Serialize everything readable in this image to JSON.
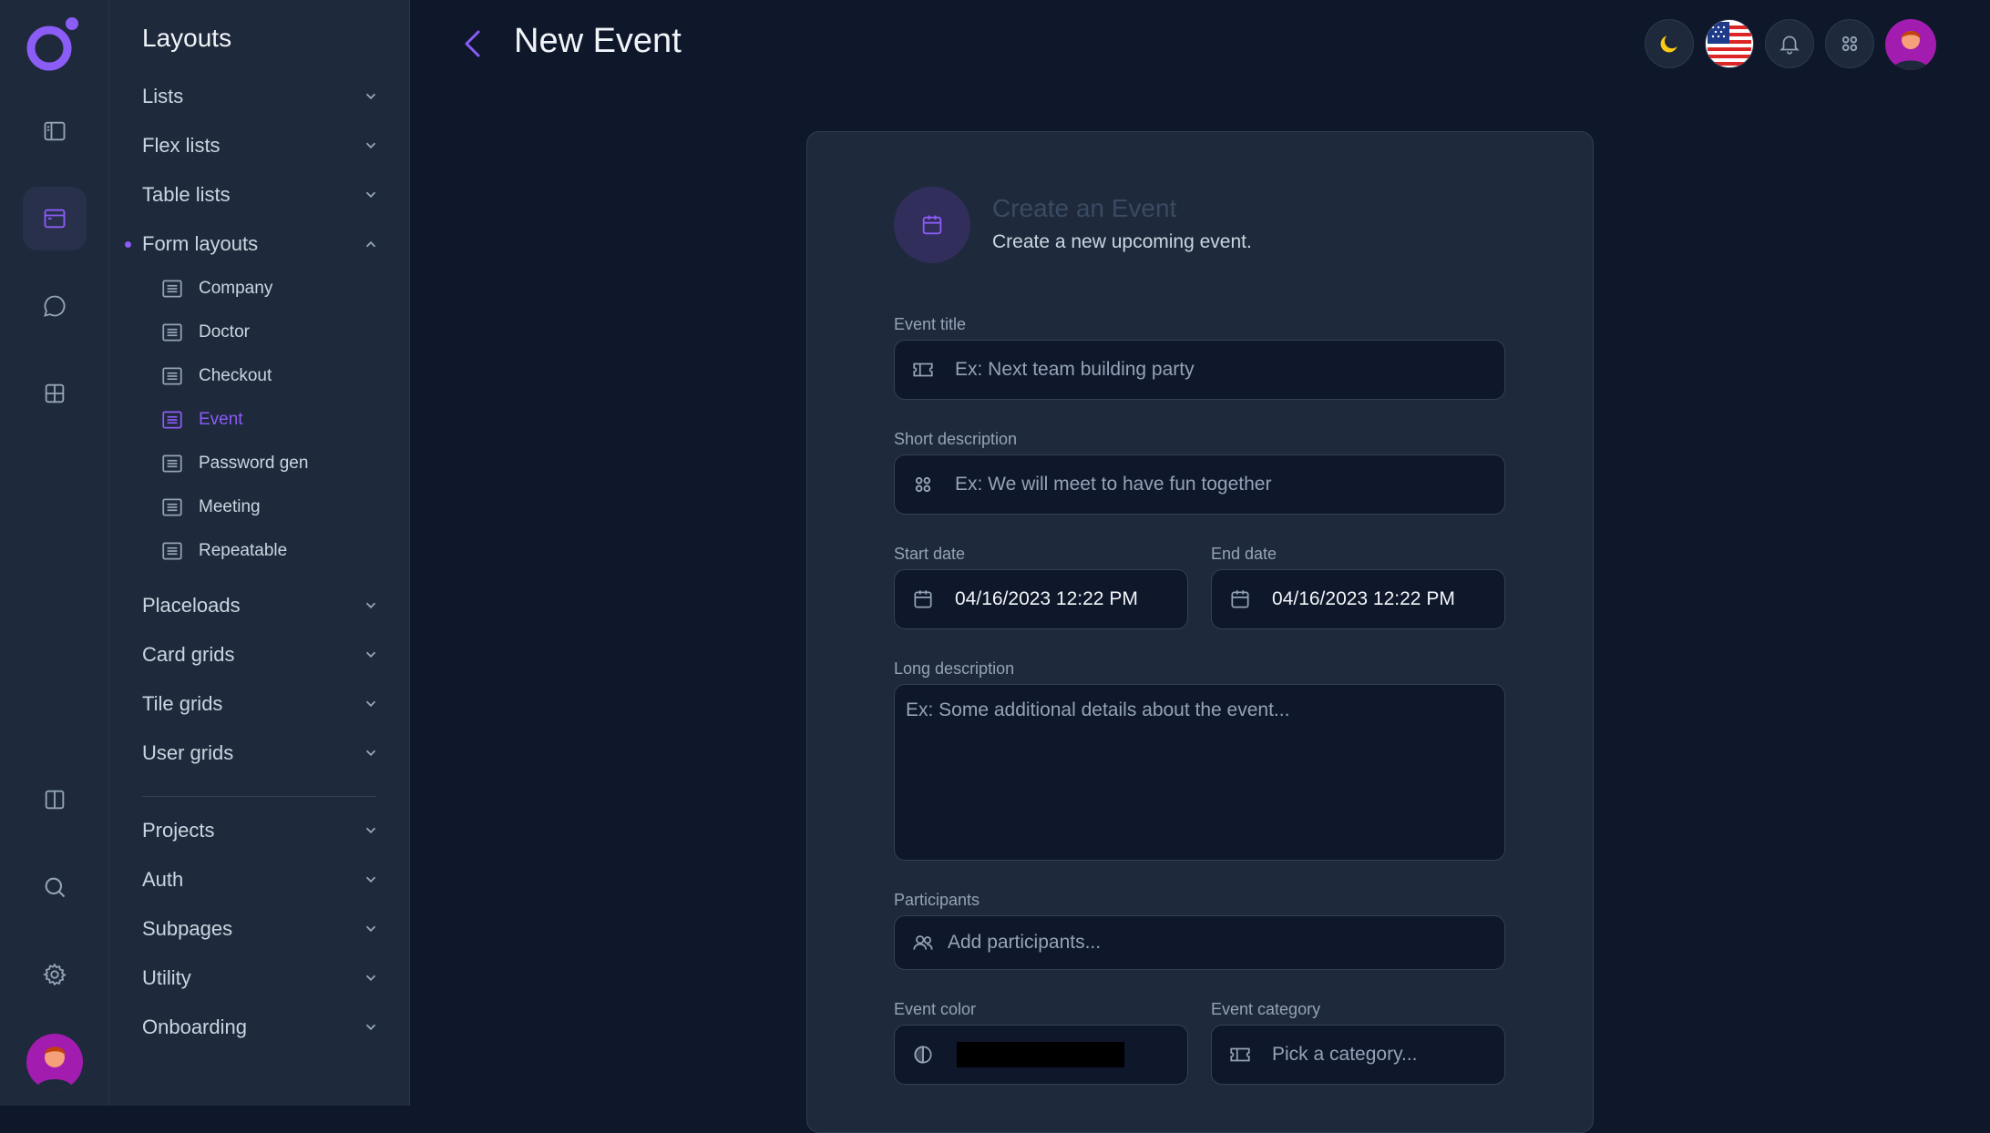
{
  "colors": {
    "accent": "#8b5cf6",
    "background": "#0f172a",
    "surface": "#1e293b",
    "swatch": "#000000",
    "moon": "#facc15"
  },
  "rail": {
    "icons": [
      "logo-icon",
      "sidebar-layout-icon",
      "window-icon",
      "chat-icon",
      "grid-icon",
      "columns-icon",
      "search-icon",
      "gear-icon"
    ]
  },
  "sidebar": {
    "title": "Layouts",
    "items": [
      {
        "label": "Lists"
      },
      {
        "label": "Flex lists"
      },
      {
        "label": "Table lists"
      },
      {
        "label": "Form layouts"
      },
      {
        "label": "Placeloads"
      },
      {
        "label": "Card grids"
      },
      {
        "label": "Tile grids"
      },
      {
        "label": "User grids"
      },
      {
        "label": "Projects"
      },
      {
        "label": "Auth"
      },
      {
        "label": "Subpages"
      },
      {
        "label": "Utility"
      },
      {
        "label": "Onboarding"
      }
    ],
    "form_layouts": [
      {
        "label": "Company"
      },
      {
        "label": "Doctor"
      },
      {
        "label": "Checkout"
      },
      {
        "label": "Event"
      },
      {
        "label": "Password gen"
      },
      {
        "label": "Meeting"
      },
      {
        "label": "Repeatable"
      }
    ]
  },
  "header": {
    "title": "New Event",
    "language_flag": "us-flag-icon"
  },
  "form": {
    "title": "Create an Event",
    "subtitle": "Create a new upcoming event.",
    "event_title": {
      "label": "Event title",
      "placeholder": "Ex: Next team building party"
    },
    "short_description": {
      "label": "Short description",
      "placeholder": "Ex: We will meet to have fun together"
    },
    "start_date": {
      "label": "Start date",
      "value": "04/16/2023 12:22 PM"
    },
    "end_date": {
      "label": "End date",
      "value": "04/16/2023 12:22 PM"
    },
    "long_description": {
      "label": "Long description",
      "placeholder": "Ex: Some additional details about the event..."
    },
    "participants": {
      "label": "Participants",
      "placeholder": "Add participants..."
    },
    "event_color": {
      "label": "Event color",
      "value": "#000000"
    },
    "event_category": {
      "label": "Event category",
      "placeholder": "Pick a category..."
    }
  }
}
